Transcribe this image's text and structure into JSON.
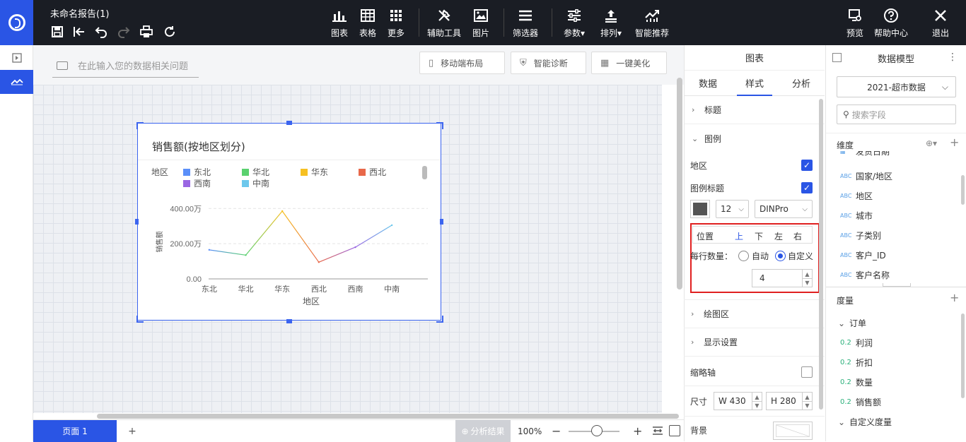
{
  "app": {
    "title": "未命名报告(1)"
  },
  "toolbar": {
    "items": [
      {
        "label": "图表"
      },
      {
        "label": "表格"
      },
      {
        "label": "更多"
      },
      {
        "label": "辅助工具"
      },
      {
        "label": "图片"
      },
      {
        "label": "筛选器"
      },
      {
        "label": "参数"
      },
      {
        "label": "排列"
      },
      {
        "label": "智能推荐"
      }
    ],
    "right": [
      {
        "label": "预览"
      },
      {
        "label": "帮助中心"
      },
      {
        "label": "退出"
      }
    ]
  },
  "query": {
    "placeholder": "在此输入您的数据相关问题",
    "buttons": [
      {
        "label": "移动端布局"
      },
      {
        "label": "智能诊断"
      },
      {
        "label": "一键美化"
      }
    ]
  },
  "chart_data": {
    "type": "line",
    "title": "销售额(按地区划分)",
    "legend_title": "地区",
    "categories": [
      "东北",
      "华北",
      "华东",
      "西北",
      "西南",
      "中南"
    ],
    "values": [
      1650000,
      1350000,
      3850000,
      950000,
      1800000,
      3050000
    ],
    "colors": [
      "#5b8ff9",
      "#5ad16f",
      "#f6c022",
      "#e8684a",
      "#9a67e3",
      "#6dc8ec"
    ],
    "yticks": [
      "0.00",
      "200.00万",
      "400.00万"
    ],
    "ylim": [
      0,
      4000000
    ],
    "xlabel": "地区",
    "ylabel": "销售额",
    "legend": [
      {
        "label": "东北",
        "color": "#5b8ff9"
      },
      {
        "label": "华北",
        "color": "#5ad16f"
      },
      {
        "label": "华东",
        "color": "#f6c022"
      },
      {
        "label": "西北",
        "color": "#e8684a"
      },
      {
        "label": "西南",
        "color": "#9a67e3"
      },
      {
        "label": "中南",
        "color": "#6dc8ec"
      }
    ]
  },
  "pagebar": {
    "page_label": "页面 1",
    "add": "+",
    "analysis": "分析结果",
    "zoom": "100%"
  },
  "props": {
    "header": "图表",
    "tabs": [
      {
        "label": "数据"
      },
      {
        "label": "样式"
      },
      {
        "label": "分析"
      }
    ],
    "sections": {
      "title": "标题",
      "legend": "图例",
      "plot": "绘图区",
      "display": "显示设置"
    },
    "legend_region": "地区",
    "legend_title": "图例标题",
    "font_size": "12",
    "font_family": "DINPro",
    "position_label": "位置",
    "positions": [
      "上",
      "下",
      "左",
      "右"
    ],
    "per_row_label": "每行数量：",
    "auto_label": "自动",
    "custom_label": "自定义",
    "per_row_value": "4",
    "axis_label": "缩略轴",
    "size_label": "尺寸",
    "width": "W 430",
    "height": "H 280",
    "background_label": "背景"
  },
  "model": {
    "header": "数据模型",
    "dataset": "2021-超市数据",
    "search_placeholder": "搜索字段",
    "dimension_label": "维度",
    "dimensions": [
      {
        "label": "发货日期",
        "type": "ABC"
      },
      {
        "label": "国家/地区",
        "type": "ABC"
      },
      {
        "label": "地区",
        "type": "ABC"
      },
      {
        "label": "城市",
        "type": "ABC"
      },
      {
        "label": "子类别",
        "type": "ABC"
      },
      {
        "label": "客户_ID",
        "type": "ABC"
      },
      {
        "label": "客户名称",
        "type": "ABC"
      }
    ],
    "measure_label": "度量",
    "measure_group": "订单",
    "measures": [
      {
        "label": "利润",
        "type": "0.2"
      },
      {
        "label": "折扣",
        "type": "0.2"
      },
      {
        "label": "数量",
        "type": "0.2"
      },
      {
        "label": "销售额",
        "type": "0.2"
      }
    ],
    "custom_measure": "自定义度量"
  }
}
